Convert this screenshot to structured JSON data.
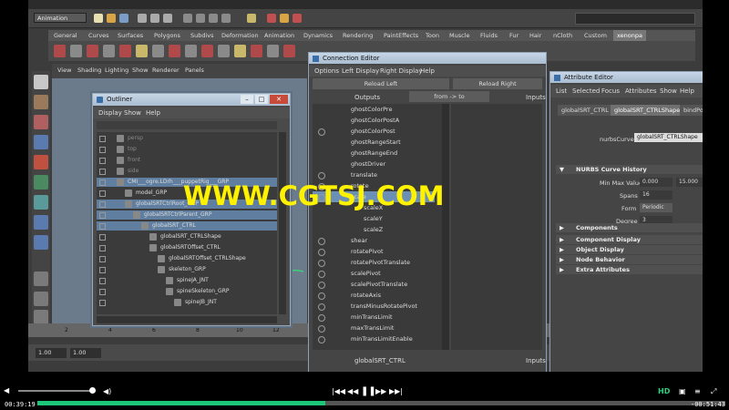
{
  "maya": {
    "mode_selector": "Animation",
    "shelf_tabs": [
      "General",
      "Curves",
      "Surfaces",
      "Polygons",
      "Subdivs",
      "Deformation",
      "Animation",
      "Dynamics",
      "Rendering",
      "PaintEffects",
      "Toon",
      "Muscle",
      "Fluids",
      "Fur",
      "Hair",
      "nCloth",
      "Custom",
      "xenonpa"
    ],
    "viewport_menu": [
      "View",
      "Shading",
      "Lighting",
      "Show",
      "Renderer",
      "Panels"
    ],
    "time_start": "1.00",
    "time_end": "1.00",
    "timeline_ticks": [
      "2",
      "4",
      "6",
      "8",
      "10",
      "12"
    ]
  },
  "outliner": {
    "title": "Outliner",
    "menu": [
      "Display",
      "Show",
      "Help"
    ],
    "rows": [
      {
        "label": "persp",
        "indent": 0,
        "selected": false,
        "dim": true
      },
      {
        "label": "top",
        "indent": 0,
        "selected": false,
        "dim": true
      },
      {
        "label": "front",
        "indent": 0,
        "selected": false,
        "dim": true
      },
      {
        "label": "side",
        "indent": 0,
        "selected": false,
        "dim": true
      },
      {
        "label": "CMI___ogre.LDrh___puppetRig___GRP",
        "indent": 0,
        "selected": true,
        "dim": false
      },
      {
        "label": "model_GRP",
        "indent": 1,
        "selected": false,
        "dim": false
      },
      {
        "label": "globalSRTCtrlRoot_GRP",
        "indent": 1,
        "selected": true,
        "dim": false
      },
      {
        "label": "globalSRTCtrlParent_GRP",
        "indent": 2,
        "selected": true,
        "dim": false
      },
      {
        "label": "globalSRT_CTRL",
        "indent": 3,
        "selected": true,
        "dim": false
      },
      {
        "label": "globalSRT_CTRLShape",
        "indent": 4,
        "selected": false,
        "dim": false
      },
      {
        "label": "globalSRTOffset_CTRL",
        "indent": 4,
        "selected": false,
        "dim": false
      },
      {
        "label": "globalSRTOffset_CTRLShape",
        "indent": 5,
        "selected": false,
        "dim": false
      },
      {
        "label": "skeleton_GRP",
        "indent": 5,
        "selected": false,
        "dim": false
      },
      {
        "label": "spineJA_JNT",
        "indent": 6,
        "selected": false,
        "dim": false
      },
      {
        "label": "spineSkeleton_GRP",
        "indent": 6,
        "selected": false,
        "dim": false
      },
      {
        "label": "spineJB_JNT",
        "indent": 7,
        "selected": false,
        "dim": false
      }
    ]
  },
  "connection_editor": {
    "title": "Connection Editor",
    "menu": [
      "Options",
      "Left Display",
      "Right Display",
      "Help"
    ],
    "reload_left": "Reload Left",
    "reload_right": "Reload Right",
    "outputs_label": "Outputs",
    "direction_button": "from -> to",
    "inputs_label": "Inputs",
    "attributes": [
      {
        "label": "ghostColorPre",
        "expand": false,
        "indent": 0
      },
      {
        "label": "ghostColorPostA",
        "expand": false,
        "indent": 0
      },
      {
        "label": "ghostColorPost",
        "expand": true,
        "indent": 0
      },
      {
        "label": "ghostRangeStart",
        "expand": false,
        "indent": 0
      },
      {
        "label": "ghostRangeEnd",
        "expand": false,
        "indent": 0
      },
      {
        "label": "ghostDriver",
        "expand": false,
        "indent": 0
      },
      {
        "label": "translate",
        "expand": true,
        "indent": 0
      },
      {
        "label": "rotate",
        "expand": true,
        "indent": 0
      },
      {
        "label": "scale",
        "expand": true,
        "indent": 0
      },
      {
        "label": "scaleX",
        "expand": false,
        "indent": 1
      },
      {
        "label": "scaleY",
        "expand": false,
        "indent": 1
      },
      {
        "label": "scaleZ",
        "expand": false,
        "indent": 1
      },
      {
        "label": "shear",
        "expand": true,
        "indent": 0
      },
      {
        "label": "rotatePivot",
        "expand": true,
        "indent": 0
      },
      {
        "label": "rotatePivotTranslate",
        "expand": true,
        "indent": 0
      },
      {
        "label": "scalePivot",
        "expand": true,
        "indent": 0
      },
      {
        "label": "scalePivotTranslate",
        "expand": true,
        "indent": 0
      },
      {
        "label": "rotateAxis",
        "expand": true,
        "indent": 0
      },
      {
        "label": "transMinusRotatePivot",
        "expand": true,
        "indent": 0
      },
      {
        "label": "minTransLimit",
        "expand": true,
        "indent": 0
      },
      {
        "label": "maxTransLimit",
        "expand": true,
        "indent": 0
      },
      {
        "label": "minTransLimitEnable",
        "expand": true,
        "indent": 0
      }
    ],
    "bottom_left_node": "globalSRT_CTRL",
    "bottom_inputs_label": "Inputs"
  },
  "attribute_editor": {
    "title": "Attribute Editor",
    "menu": [
      "List",
      "Selected",
      "Focus",
      "Attributes",
      "Show",
      "Help"
    ],
    "tabs": [
      "globalSRT_CTRL",
      "globalSRT_CTRLShape",
      "bindPose1"
    ],
    "active_tab": 1,
    "node_type_label": "nurbsCurve:",
    "node_name": "globalSRT_CTRLShape",
    "history_section": "NURBS Curve History",
    "min_max_label": "Min Max Value",
    "min_value": "0.000",
    "max_value": "15.000",
    "spans_label": "Spans",
    "spans_value": "16",
    "form_label": "Form",
    "form_value": "Periodic",
    "degree_label": "Degree",
    "degree_value": "3",
    "sections": [
      "Components",
      "Component Display",
      "Object Display",
      "Node Behavior",
      "Extra Attributes"
    ]
  },
  "watermark": "WWW.CGTSJ.COM",
  "player": {
    "current_time": "00:39:19",
    "remaining_time": "-00:51:43",
    "progress": 0.418,
    "volume": 0.95,
    "hd_label": "HD"
  }
}
